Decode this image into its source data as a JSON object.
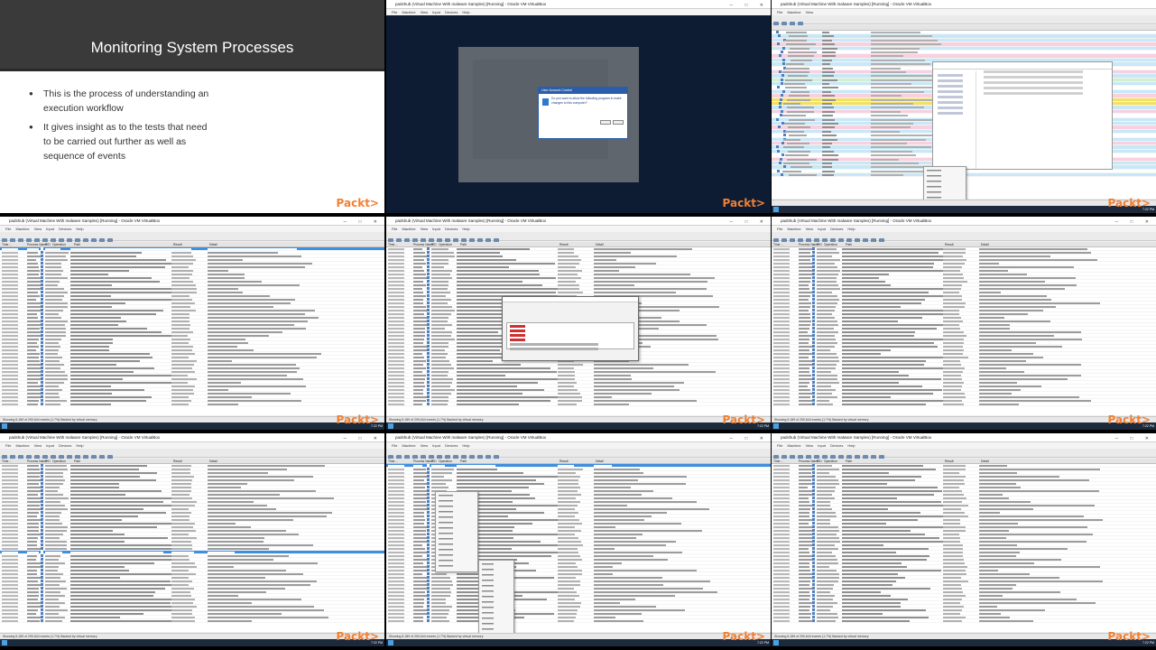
{
  "slide": {
    "title": "Monitoring System Processes",
    "bullets": [
      "This is the process of understanding an execution workflow",
      "It gives insight as to the tests that need to be carried out further as well as sequence of events"
    ],
    "logo": "Packt>"
  },
  "vm": {
    "window_title": "padshub (Virtual Machine With malware Samples) [Running] - Oracle VM VirtualBox",
    "menu": [
      "File",
      "Machine",
      "View",
      "Input",
      "Devices",
      "Help"
    ],
    "procmon_title": "Process Monitor - Sysinternals: www.sysinternals.com",
    "procmon_menu": [
      "File",
      "Edit",
      "Event",
      "Filter",
      "Tools",
      "Options",
      "Help"
    ],
    "columns": [
      "Time ...",
      "Process Name",
      "PID",
      "Operation",
      "Path",
      "Result",
      "Detail"
    ],
    "status": "Showing 5,189 of 290,644 events (1.7%)     Backed by virtual memory",
    "clock": "7:22 PM",
    "uac": {
      "title": "User Account Control",
      "message": "Do you want to allow the following program to make changes to this computer?"
    },
    "logo": "Packt>"
  },
  "colors": {
    "slide_band": "#3a3a3a",
    "packt_orange": "#f08034",
    "selection": "#3d8fe0",
    "desktop": "#0e1c33"
  }
}
